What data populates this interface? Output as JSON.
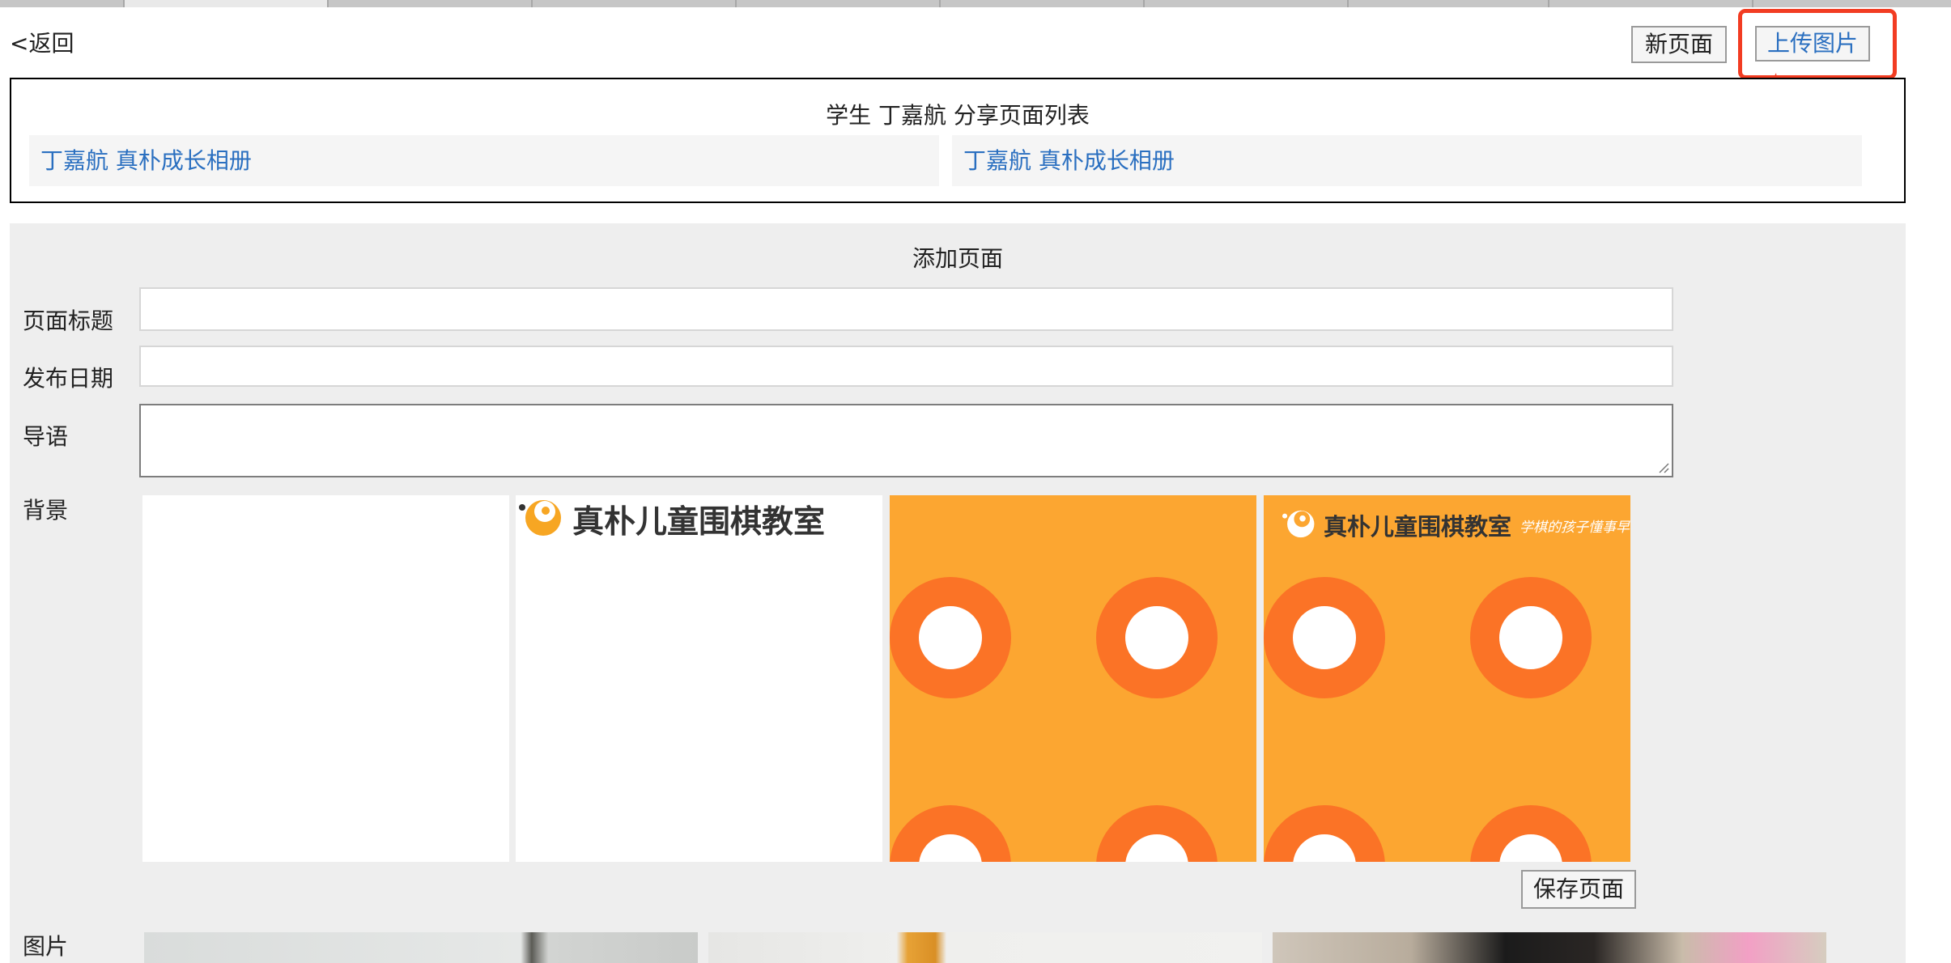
{
  "nav": {
    "back_label": "<返回"
  },
  "toolbar": {
    "new_page_label": "新页面",
    "upload_image_label": "上传图片"
  },
  "share_list": {
    "title": "学生 丁嘉航 分享页面列表",
    "items": [
      {
        "label": "丁嘉航 真朴成长相册"
      },
      {
        "label": "丁嘉航 真朴成长相册"
      }
    ]
  },
  "add_page": {
    "title": "添加页面",
    "fields": {
      "page_title": {
        "label": "页面标题",
        "value": ""
      },
      "publish_date": {
        "label": "发布日期",
        "value": ""
      },
      "intro": {
        "label": "导语",
        "value": ""
      }
    },
    "background_label": "背景",
    "backgrounds": [
      {
        "name": "plain-white"
      },
      {
        "name": "logo-white",
        "logo_text": "真朴儿童围棋教室"
      },
      {
        "name": "orange-rings"
      },
      {
        "name": "orange-rings-logo",
        "logo_text": "真朴儿童围棋教室",
        "slogan": "学棋的孩子懂事早。"
      }
    ],
    "save_label": "保存页面",
    "images_label": "图片"
  },
  "colors": {
    "link": "#2a6fc0",
    "highlight": "#f23c22",
    "orange": "#fca631",
    "ring": "#fb7326",
    "panel": "#eeeeee"
  }
}
